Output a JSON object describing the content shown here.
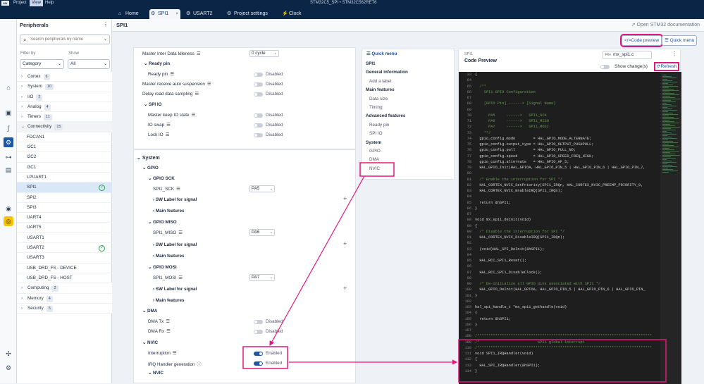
{
  "titlebar": {
    "logo": "MX",
    "menu": [
      "Project",
      "View",
      "Help"
    ],
    "window_title": "STM32C5_SPI  •  STM32C562RET6"
  },
  "tabs": [
    {
      "label": "Home",
      "icon": "⌂"
    },
    {
      "label": "SPI1",
      "icon": "⚙",
      "close": "×"
    },
    {
      "label": "USART2",
      "icon": "⚙"
    },
    {
      "label": "Project settings",
      "icon": "⚙"
    },
    {
      "label": "Clock",
      "icon": "⚡"
    }
  ],
  "peripherals": {
    "title": "Peripherals",
    "search_placeholder": "Search peripherals by name",
    "filter_by_label": "Filter by",
    "show_label": "Show",
    "filter_value": "Category",
    "show_value": "All",
    "rows": [
      {
        "kind": "cat",
        "label": "Cortex",
        "count": "6"
      },
      {
        "kind": "cat",
        "label": "System",
        "count": "10"
      },
      {
        "kind": "cat",
        "label": "I/O",
        "count": "2"
      },
      {
        "kind": "cat",
        "label": "Analog",
        "count": "4"
      },
      {
        "kind": "cat",
        "label": "Timers",
        "count": "11"
      },
      {
        "kind": "cat",
        "label": "Connectivity",
        "count": "15",
        "open": true
      },
      {
        "kind": "item",
        "label": "FDCAN1"
      },
      {
        "kind": "item",
        "label": "I2C1"
      },
      {
        "kind": "item",
        "label": "I2C2"
      },
      {
        "kind": "item",
        "label": "I3C1"
      },
      {
        "kind": "item",
        "label": "LPUART1"
      },
      {
        "kind": "item",
        "label": "SPI1",
        "selected": true,
        "ok": true
      },
      {
        "kind": "item",
        "label": "SPI2"
      },
      {
        "kind": "item",
        "label": "SPI3"
      },
      {
        "kind": "item",
        "label": "UART4"
      },
      {
        "kind": "item",
        "label": "UART5"
      },
      {
        "kind": "item",
        "label": "USART1"
      },
      {
        "kind": "item",
        "label": "USART2",
        "ok": true
      },
      {
        "kind": "item",
        "label": "USART3"
      },
      {
        "kind": "item",
        "label": "USB_DRD_FS - DEVICE"
      },
      {
        "kind": "item",
        "label": "USB_DRD_FS - HOST"
      },
      {
        "kind": "cat",
        "label": "Computing",
        "count": "2"
      },
      {
        "kind": "cat",
        "label": "Memory",
        "count": "4"
      },
      {
        "kind": "cat",
        "label": "Security",
        "count": "5"
      }
    ]
  },
  "main": {
    "title": "SPI1",
    "doc_link": "Open STM32 documentation",
    "code_preview_btn": "</>Code preview",
    "quick_menu_btn": "Quick menu"
  },
  "config_top": {
    "master_idle": {
      "label": "Master Inter Data Idleness",
      "value": "0 cycle"
    },
    "ready_pin_section": "Ready pin",
    "ready_pin": "Ready pin",
    "master_receive": "Master receive auto suspension",
    "delay_read": "Delay read data sampling",
    "spi_io": "SPI IO",
    "master_keep": "Master keep IO state",
    "io_swap": "IO swap",
    "lock_io": "Lock IO",
    "disabled": "Disabled",
    "enabled": "Enabled"
  },
  "config_system": {
    "system": "System",
    "gpio": "GPIO",
    "gpio_sck": "GPIO SCK",
    "spi1_sck": "SPI1_SCK",
    "sck_pin": "PA5",
    "sw_label": "SW Label for signal",
    "main_features": "Main features",
    "gpio_miso": "GPIO MISO",
    "spi1_miso": "SPI1_MISO",
    "miso_pin": "PA6",
    "gpio_mosi": "GPIO MOSI",
    "spi1_mosi": "SPI1_MOSI",
    "mosi_pin": "PA7",
    "dma": "DMA",
    "dma_tx": "DMA Tx",
    "dma_rx": "DMA Rx",
    "nvic": "NVIC",
    "interruption": "Interruption",
    "irq_handler": "IRQ Handler generation",
    "nvic2": "NVIC"
  },
  "quick_menu": {
    "title": "Quick menu",
    "items": [
      {
        "label": "SPI1",
        "bold": true
      },
      {
        "label": "General information",
        "bold": true
      },
      {
        "label": "Add a label",
        "sub": true
      },
      {
        "label": "Main features",
        "bold": true
      },
      {
        "label": "Data size",
        "sub": true
      },
      {
        "label": "Timing",
        "sub": true
      },
      {
        "label": "Advanced features",
        "bold": true
      },
      {
        "label": "Ready pin",
        "sub": true
      },
      {
        "label": "SPI IO",
        "sub": true
      },
      {
        "label": "System",
        "bold": true
      },
      {
        "label": "GPIO",
        "sub": true
      },
      {
        "label": "DMA",
        "sub": true
      },
      {
        "label": "NVIC",
        "sub": true
      }
    ]
  },
  "code_preview": {
    "small_title": "SPI1",
    "title": "Code Preview",
    "file_label": "File",
    "file_value": "mx_spi1.c",
    "show_changes": "Show change(s)",
    "refresh": "Refresh",
    "lines": [
      {
        "n": "33",
        "t": "{"
      },
      {
        "n": "64",
        "t": ""
      },
      {
        "n": "65",
        "t": "  /**",
        "c": 1
      },
      {
        "n": "66",
        "t": "    SPI1 GPIO Configuration",
        "c": 1
      },
      {
        "n": "67",
        "t": "",
        "c": 1
      },
      {
        "n": "68",
        "t": "    [GPIO Pin] ------> [Signal Name]",
        "c": 1
      },
      {
        "n": "69",
        "t": "",
        "c": 1
      },
      {
        "n": "70",
        "t": "      PA5     ------>   SPI1_SCK",
        "c": 1
      },
      {
        "n": "71",
        "t": "      PA6     ------>   SPI1_MISO",
        "c": 1
      },
      {
        "n": "72",
        "t": "      PA7     ------>   SPI1_MOSI",
        "c": 1
      },
      {
        "n": "73",
        "t": "    **/",
        "c": 1
      },
      {
        "n": "74",
        "t": "  gpio_config.mode        = HAL_GPIO_MODE_ALTERNATE;"
      },
      {
        "n": "75",
        "t": "  gpio_config.output_type = HAL_GPIO_OUTPUT_PUSHPULL;"
      },
      {
        "n": "76",
        "t": "  gpio_config.pull        = HAL_GPIO_PULL_NO;"
      },
      {
        "n": "77",
        "t": "  gpio_config.speed       = HAL_GPIO_SPEED_FREQ_HIGH;"
      },
      {
        "n": "78",
        "t": "  gpio_config.alternate   = HAL_GPIO_AF_5;"
      },
      {
        "n": "79",
        "t": "  HAL_GPIO_Init(HAL_GPIOA, HAL_GPIO_PIN_5 | HAL_GPIO_PIN_6 | HAL_GPIO_PIN_7,"
      },
      {
        "n": "80",
        "t": ""
      },
      {
        "n": "81",
        "t": "  /* Enable the interruption for SPI */",
        "c": 1
      },
      {
        "n": "82",
        "t": "  HAL_CORTEX_NVIC_SetPriority(SPI1_IRQn, HAL_CORTEX_NVIC_PREEMP_PRIORITY_0,"
      },
      {
        "n": "83",
        "t": "  HAL_CORTEX_NVIC_EnableIRQ(SPI1_IRQn);"
      },
      {
        "n": "84",
        "t": ""
      },
      {
        "n": "85",
        "t": "  return &hSPI1;"
      },
      {
        "n": "86",
        "t": "}"
      },
      {
        "n": "87",
        "t": ""
      },
      {
        "n": "88",
        "t": "void mx_spi1_deinit(void)"
      },
      {
        "n": "89",
        "t": "{"
      },
      {
        "n": "90",
        "t": "  /* Disable the interruption for SPI */",
        "c": 1
      },
      {
        "n": "91",
        "t": "  HAL_CORTEX_NVIC_DisableIRQ(SPI1_IRQn);"
      },
      {
        "n": "92",
        "t": ""
      },
      {
        "n": "93",
        "t": "  (void)HAL_SPI_DeInit(&hSPI1);"
      },
      {
        "n": "94",
        "t": ""
      },
      {
        "n": "95",
        "t": "  HAL_RCC_SPI1_Reset();"
      },
      {
        "n": "96",
        "t": ""
      },
      {
        "n": "97",
        "t": "  HAL_RCC_SPI1_DisableClock();"
      },
      {
        "n": "98",
        "t": ""
      },
      {
        "n": "99",
        "t": "  /* De-initialize all GPIO pins associated with SPI1 */",
        "c": 1
      },
      {
        "n": "100",
        "t": "  HAL_GPIO_DeInit(HAL_GPIOA, HAL_GPIO_PIN_5 | HAL_GPIO_PIN_6 | HAL_GPIO_PIN_"
      },
      {
        "n": "101",
        "t": "}"
      },
      {
        "n": "102",
        "t": ""
      },
      {
        "n": "103",
        "t": "hal_spi_handle_t *mx_spi1_gethandle(void)"
      },
      {
        "n": "104",
        "t": "{"
      },
      {
        "n": "105",
        "t": "  return &hSPI1;"
      },
      {
        "n": "106",
        "t": "}"
      },
      {
        "n": "107",
        "t": ""
      },
      {
        "n": "108",
        "t": "/******************************************************************************",
        "c": 1
      },
      {
        "n": "109",
        "t": "/*                          SPI1 global interrupt",
        "c": 1
      },
      {
        "n": "110",
        "t": "/******************************************************************************",
        "c": 1
      },
      {
        "n": "111",
        "t": "void SPI1_IRQHandler(void)"
      },
      {
        "n": "112",
        "t": "{"
      },
      {
        "n": "113",
        "t": "  HAL_SPI_IRQHandler(&hSPI1);"
      },
      {
        "n": "114",
        "t": "}"
      }
    ]
  },
  "colors": {
    "accent": "#1c56a6",
    "highlight": "#e0197d",
    "header_bg": "#0b2546"
  }
}
